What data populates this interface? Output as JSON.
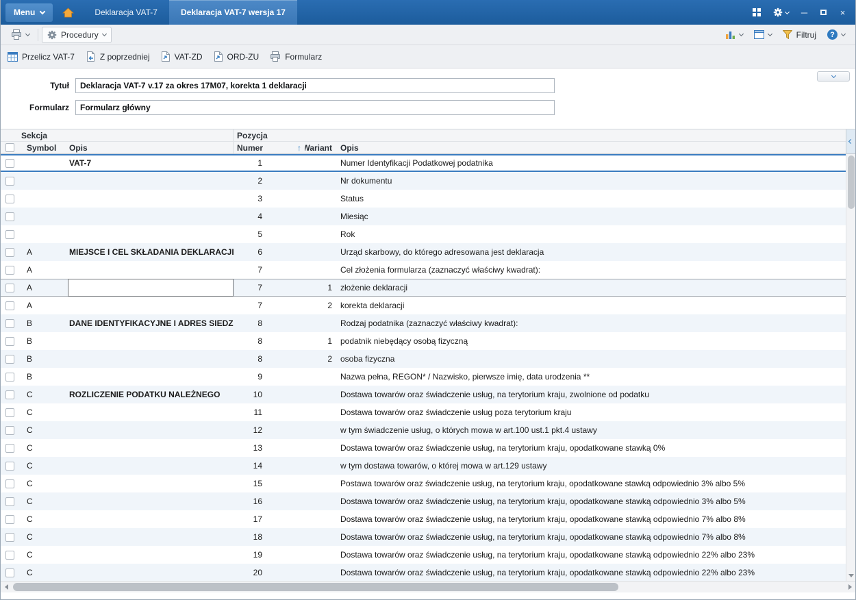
{
  "titlebar": {
    "menu_label": "Menu",
    "tabs": [
      {
        "label": "Deklaracja VAT-7"
      },
      {
        "label": "Deklaracja VAT-7 wersja 17"
      }
    ]
  },
  "toolbar": {
    "procedures_label": "Procedury",
    "filter_label": "Filtruj"
  },
  "actions": [
    {
      "label": "Przelicz VAT-7"
    },
    {
      "label": "Z poprzedniej"
    },
    {
      "label": "VAT-ZD"
    },
    {
      "label": "ORD-ZU"
    },
    {
      "label": "Formularz"
    }
  ],
  "form": {
    "title_label": "Tytuł",
    "title_value": "Deklaracja VAT-7 v.17 za okres 17M07, korekta 1 deklaracji",
    "form_label": "Formularz",
    "form_value": "Formularz główny"
  },
  "icons": {
    "sort_glyph": "↑",
    "minimize_glyph": "─",
    "close_glyph": "×",
    "help_glyph": "?"
  },
  "colors": {
    "titlebar_blue": "#1c5c9c",
    "accent_blue": "#3a7cc0",
    "stripe_row": "#f0f5fa"
  },
  "grid": {
    "group_sekcja": "Sekcja",
    "group_pozycja": "Pozycja",
    "col_symbol": "Symbol",
    "col_opis": "Opis",
    "col_numer": "Numer",
    "col_wariant": "Wariant",
    "col_opis2": "Opis",
    "rows": [
      {
        "symbol": "",
        "opis": "VAT-7",
        "bold": true,
        "numer": "1",
        "wariant": "",
        "opis2": "Numer Identyfikacji Podatkowej podatnika",
        "selected": true
      },
      {
        "symbol": "",
        "opis": "",
        "numer": "2",
        "wariant": "",
        "opis2": "Nr dokumentu"
      },
      {
        "symbol": "",
        "opis": "",
        "numer": "3",
        "wariant": "",
        "opis2": "Status"
      },
      {
        "symbol": "",
        "opis": "",
        "numer": "4",
        "wariant": "",
        "opis2": "Miesiąc"
      },
      {
        "symbol": "",
        "opis": "",
        "numer": "5",
        "wariant": "",
        "opis2": "Rok"
      },
      {
        "symbol": "A",
        "opis": "MIEJSCE I CEL SKŁADANIA DEKLARACJI",
        "bold": true,
        "numer": "6",
        "wariant": "",
        "opis2": "Urząd skarbowy, do którego adresowana jest deklaracja"
      },
      {
        "symbol": "A",
        "opis": "",
        "numer": "7",
        "wariant": "",
        "opis2": "Cel złożenia formularza (zaznaczyć właściwy kwadrat):"
      },
      {
        "symbol": "A",
        "opis": "",
        "numer": "7",
        "wariant": "1",
        "opis2": "złożenie deklaracji",
        "focus": true
      },
      {
        "symbol": "A",
        "opis": "",
        "numer": "7",
        "wariant": "2",
        "opis2": "korekta deklaracji"
      },
      {
        "symbol": "B",
        "opis": "DANE IDENTYFIKACYJNE I ADRES SIEDZIBY*",
        "bold": true,
        "numer": "8",
        "wariant": "",
        "opis2": "Rodzaj podatnika (zaznaczyć właściwy kwadrat):"
      },
      {
        "symbol": "B",
        "opis": "",
        "numer": "8",
        "wariant": "1",
        "opis2": "podatnik niebędący osobą fizyczną"
      },
      {
        "symbol": "B",
        "opis": "",
        "numer": "8",
        "wariant": "2",
        "opis2": "osoba fizyczna"
      },
      {
        "symbol": "B",
        "opis": "",
        "numer": "9",
        "wariant": "",
        "opis2": "Nazwa pełna, REGON* / Nazwisko, pierwsze imię, data urodzenia **"
      },
      {
        "symbol": "C",
        "opis": "ROZLICZENIE PODATKU NALEŻNEGO",
        "bold": true,
        "numer": "10",
        "wariant": "",
        "opis2": "Dostawa towarów oraz świadczenie usług, na terytorium kraju, zwolnione od podatku"
      },
      {
        "symbol": "C",
        "opis": "",
        "numer": "11",
        "wariant": "",
        "opis2": "Dostawa towarów oraz świadczenie usług poza terytorium  kraju"
      },
      {
        "symbol": "C",
        "opis": "",
        "numer": "12",
        "wariant": "",
        "opis2": "w tym świadczenie usług, o których mowa w art.100  ust.1 pkt.4 ustawy"
      },
      {
        "symbol": "C",
        "opis": "",
        "numer": "13",
        "wariant": "",
        "opis2": "Dostawa towarów oraz świadczenie usług, na terytorium kraju, opodatkowane stawką 0%"
      },
      {
        "symbol": "C",
        "opis": "",
        "numer": "14",
        "wariant": "",
        "opis2": "w tym dostawa towarów, o której mowa w art.129 ustawy"
      },
      {
        "symbol": "C",
        "opis": "",
        "numer": "15",
        "wariant": "",
        "opis2": "Postawa towarów oraz świadczenie usług, na terytorium kraju, opodatkowane stawką odpowiednio 3% albo 5%"
      },
      {
        "symbol": "C",
        "opis": "",
        "numer": "16",
        "wariant": "",
        "opis2": "Dostawa towarów oraz świadczenie usług, na terytorium kraju, opodatkowane stawką odpowiednio 3% albo 5%"
      },
      {
        "symbol": "C",
        "opis": "",
        "numer": "17",
        "wariant": "",
        "opis2": "Dostawa towarów oraz świadczenie usług, na terytorium kraju, opodatkowane stawką odpowiednio 7% albo 8%"
      },
      {
        "symbol": "C",
        "opis": "",
        "numer": "18",
        "wariant": "",
        "opis2": "Dostawa towarów oraz świadczenie usług, na terytorium kraju, opodatkowane stawką odpowiednio 7% albo 8%"
      },
      {
        "symbol": "C",
        "opis": "",
        "numer": "19",
        "wariant": "",
        "opis2": "Dostawa towarów oraz świadczenie usług, na terytorium kraju, opodatkowane stawką odpowiednio 22% albo 23%"
      },
      {
        "symbol": "C",
        "opis": "",
        "numer": "20",
        "wariant": "",
        "opis2": "Dostawa towarów oraz świadczenie usług, na terytorium kraju, opodatkowane stawką odpowiednio 22% albo 23%"
      }
    ]
  }
}
